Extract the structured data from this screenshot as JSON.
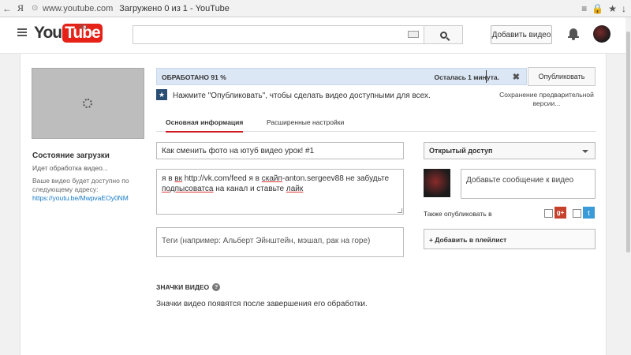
{
  "browser": {
    "back_icon": "←",
    "ya_icon": "Я",
    "url": "www.youtube.com",
    "page_title": "Загружено 0 из 1 - YouTube",
    "menu_icon": "≡",
    "security_icon": "🔒",
    "star_icon": "★",
    "download_icon": "↓"
  },
  "header": {
    "logo_you": "You",
    "logo_tube": "Tube",
    "logo_region": "RU",
    "search_placeholder": "",
    "upload_label": "Добавить видео"
  },
  "upload_status": {
    "title": "Состояние загрузки",
    "processing_text": "Идет обработка видео...",
    "availability_note": "Ваше видео будет доступно по следующему адресу:",
    "video_link": "https://youtu.be/MwpvaEOy0NM"
  },
  "progress": {
    "percent_label": "ОБРАБОТАНО 91 %",
    "percent_value": 91,
    "remaining_label": "Осталась 1 минута.",
    "close_label": "✖"
  },
  "publish_label": "Опубликовать",
  "hint_text": "Нажмите \"Опубликовать\", чтобы сделать видео доступными для всех.",
  "preview_save_text": "Сохранение предварительной версии...",
  "tabs": [
    {
      "label": "Основная информация",
      "active": true
    },
    {
      "label": "Расширенные настройки",
      "active": false
    }
  ],
  "form": {
    "title_value": "Как сменить фото на ютуб видео урок! #1",
    "description": {
      "part1": "я в ",
      "link_vk": "вк",
      "part2": " http://vk.com/feed я в ",
      "link_skype": "скайп",
      "part3": "-anton.sergeev88 не забудьте ",
      "word_subscribe": "подпысоватса",
      "part4": " на канал и ставьте ",
      "word_like": "лайк"
    },
    "tags_placeholder": "Теги (например: Альберт Эйнштейн, мэшап, рак на горе)"
  },
  "sidebar": {
    "access_value": "Открытый доступ",
    "message_placeholder": "Добавьте сообщение к видео",
    "also_publish_label": "Также опубликовать в",
    "gplus_icon": "g+",
    "twitter_icon": "🐦",
    "playlist_label": "+ Добавить в плейлист"
  },
  "badges": {
    "title": "ЗНАЧКИ ВИДЕО",
    "help_icon": "?",
    "text": "Значки видео появятся после завершения его обработки."
  },
  "colors": {
    "accent_red": "#e62117",
    "progress_bg": "#dce7f5",
    "link_blue": "#167ac6"
  }
}
